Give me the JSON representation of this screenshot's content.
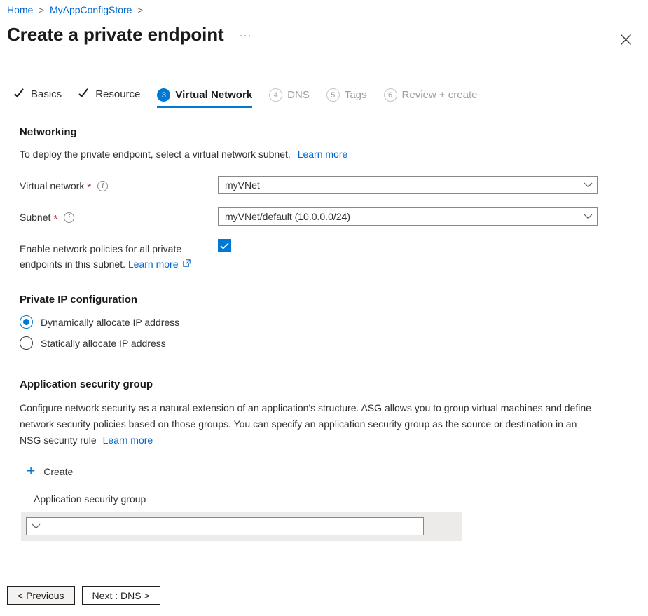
{
  "breadcrumb": {
    "items": [
      {
        "label": "Home"
      },
      {
        "label": "MyAppConfigStore"
      }
    ],
    "separator": ">"
  },
  "header": {
    "title": "Create a private endpoint",
    "ellipsis_label": "···",
    "close_label": "×"
  },
  "tabs": [
    {
      "label": "Basics",
      "state": "done",
      "marker": "check"
    },
    {
      "label": "Resource",
      "state": "done",
      "marker": "check"
    },
    {
      "label": "Virtual Network",
      "state": "active",
      "marker": "3"
    },
    {
      "label": "DNS",
      "state": "todo",
      "marker": "4"
    },
    {
      "label": "Tags",
      "state": "todo",
      "marker": "5"
    },
    {
      "label": "Review + create",
      "state": "todo",
      "marker": "6"
    }
  ],
  "networking": {
    "heading": "Networking",
    "description": "To deploy the private endpoint, select a virtual network subnet.",
    "description_link": "Learn more",
    "virtual_network": {
      "label": "Virtual network",
      "required_marker": "*",
      "info_glyph": "i",
      "value": "myVNet"
    },
    "subnet": {
      "label": "Subnet",
      "required_marker": "*",
      "info_glyph": "i",
      "value": "myVNet/default (10.0.0.0/24)"
    },
    "network_policies": {
      "label_line1": "Enable network policies for all private",
      "label_line2": "endpoints in this subnet.",
      "link": "Learn more",
      "checked": true
    }
  },
  "private_ip": {
    "heading": "Private IP configuration",
    "options": [
      {
        "label": "Dynamically allocate IP address",
        "selected": true
      },
      {
        "label": "Statically allocate IP address",
        "selected": false
      }
    ]
  },
  "asg": {
    "heading": "Application security group",
    "description": "Configure network security as a natural extension of an application's structure. ASG allows you to group virtual machines and define network security policies based on those groups. You can specify an application security group as the source or destination in an NSG security rule",
    "description_link": "Learn more",
    "create_label": "Create",
    "field_label": "Application security group",
    "field_value": ""
  },
  "footer": {
    "previous_label": "< Previous",
    "next_label": "Next : DNS >"
  },
  "colors": {
    "accent": "#0078d4",
    "link": "#0066cc",
    "required": "#a4262c",
    "muted": "#a19f9d",
    "panel": "#edebe9"
  }
}
